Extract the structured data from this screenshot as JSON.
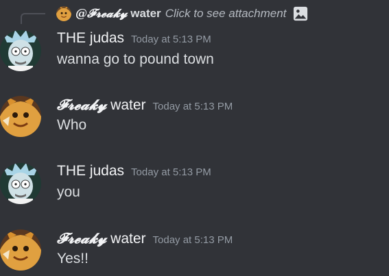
{
  "reply": {
    "name_styled": "@𝓕𝓻𝓮𝓪𝓴𝔂",
    "name_plain": "water",
    "hint": "Click to see attachment",
    "attachment_icon": "image-icon"
  },
  "messages": [
    {
      "name_styled": "",
      "name_plain": "THE judas",
      "timestamp": "Today at 5:13 PM",
      "text": "wanna go to pound town",
      "avatar": "rick-avatar"
    },
    {
      "name_styled": "𝓕𝓻𝓮𝓪𝓴𝔂",
      "name_plain": "water",
      "timestamp": "Today at 5:13 PM",
      "text": "Who",
      "avatar": "fox-avatar"
    },
    {
      "name_styled": "",
      "name_plain": "THE judas",
      "timestamp": "Today at 5:13 PM",
      "text": "you",
      "avatar": "rick-avatar"
    },
    {
      "name_styled": "𝓕𝓻𝓮𝓪𝓴𝔂",
      "name_plain": "water",
      "timestamp": "Today at 5:13 PM",
      "text": "Yes!!",
      "avatar": "fox-avatar"
    }
  ],
  "colors": {
    "background": "#313338",
    "text": "#dbdee1",
    "muted": "#949ba4"
  }
}
